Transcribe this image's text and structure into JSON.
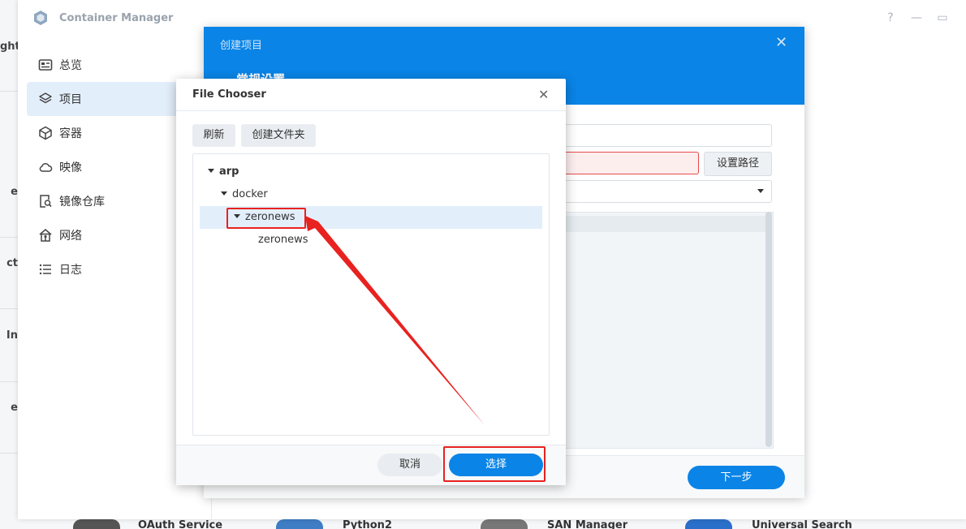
{
  "background": {
    "left_strip": [
      "ght",
      "e",
      "ct",
      "In",
      "e"
    ],
    "bottom_apps": [
      "OAuth Service",
      "Python2",
      "SAN Manager",
      "Universal Search"
    ]
  },
  "main_window": {
    "title": "Container Manager",
    "buttons": {
      "help": "?",
      "minimize": "—",
      "maximize": "▭"
    },
    "nav": [
      {
        "label": "总览",
        "icon": "overview-icon"
      },
      {
        "label": "项目",
        "icon": "layers-icon",
        "active": true
      },
      {
        "label": "容器",
        "icon": "cube-icon"
      },
      {
        "label": "映像",
        "icon": "cloud-icon"
      },
      {
        "label": "镜像仓库",
        "icon": "registry-search-icon"
      },
      {
        "label": "网络",
        "icon": "network-icon"
      },
      {
        "label": "日志",
        "icon": "list-icon"
      }
    ]
  },
  "wizard": {
    "title": "创建项目",
    "close": "✕",
    "section": "常规设置",
    "set_path_button": "设置路径",
    "next_button": "下一步"
  },
  "file_chooser": {
    "title": "File Chooser",
    "close": "✕",
    "refresh_button": "刷新",
    "create_folder_button": "创建文件夹",
    "tree": [
      {
        "label": "arp",
        "level": 0,
        "expanded": true
      },
      {
        "label": "docker",
        "level": 1,
        "expanded": true
      },
      {
        "label": "zeronews",
        "level": 2,
        "expanded": true,
        "selected": true
      },
      {
        "label": "zeronews",
        "level": 3,
        "expanded": false
      }
    ],
    "cancel_button": "取消",
    "select_button": "选择"
  },
  "colors": {
    "accent": "#0a84e6",
    "annotation": "#e8221f"
  }
}
